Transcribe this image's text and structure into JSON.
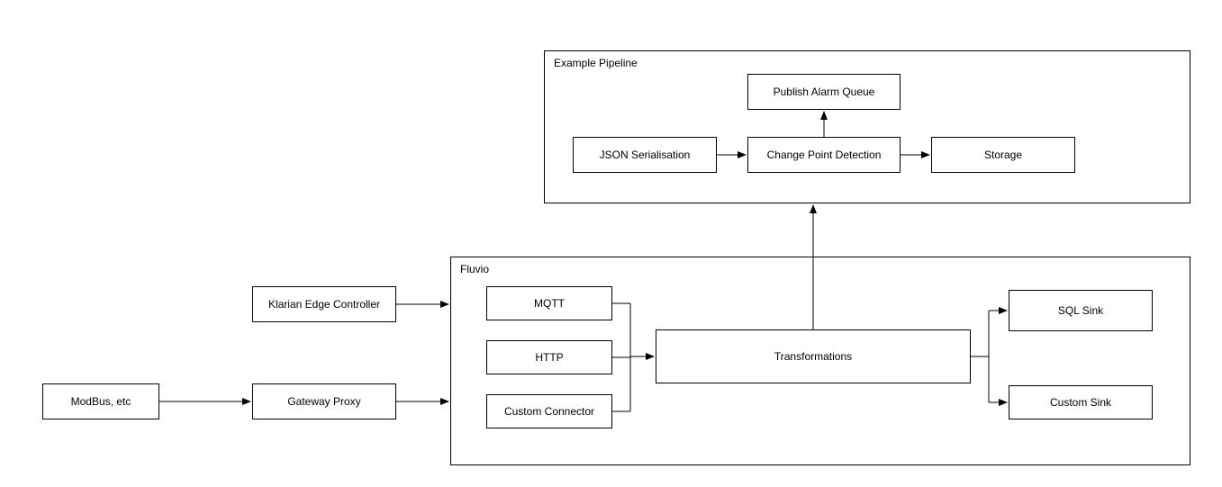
{
  "diagram": {
    "containers": {
      "pipeline": {
        "label": "Example Pipeline"
      },
      "fluvio": {
        "label": "Fluvio"
      }
    },
    "nodes": {
      "modbus": "ModBus, etc",
      "klarian": "Klarian Edge Controller",
      "gateway": "Gateway Proxy",
      "mqtt": "MQTT",
      "http": "HTTP",
      "custom_conn": "Custom Connector",
      "transform": "Transformations",
      "sql_sink": "SQL Sink",
      "custom_sink": "Custom Sink",
      "json_serial": "JSON Serialisation",
      "change_point": "Change Point Detection",
      "storage": "Storage",
      "publish_alarm": "Publish Alarm Queue"
    },
    "edges": [
      [
        "modbus",
        "gateway"
      ],
      [
        "gateway",
        "fluvio"
      ],
      [
        "klarian",
        "fluvio"
      ],
      [
        "mqtt+http+custom_conn",
        "transform"
      ],
      [
        "transform",
        "sql_sink+custom_sink"
      ],
      [
        "transform",
        "change_point"
      ],
      [
        "json_serial",
        "change_point"
      ],
      [
        "change_point",
        "storage"
      ],
      [
        "change_point",
        "publish_alarm"
      ]
    ]
  }
}
